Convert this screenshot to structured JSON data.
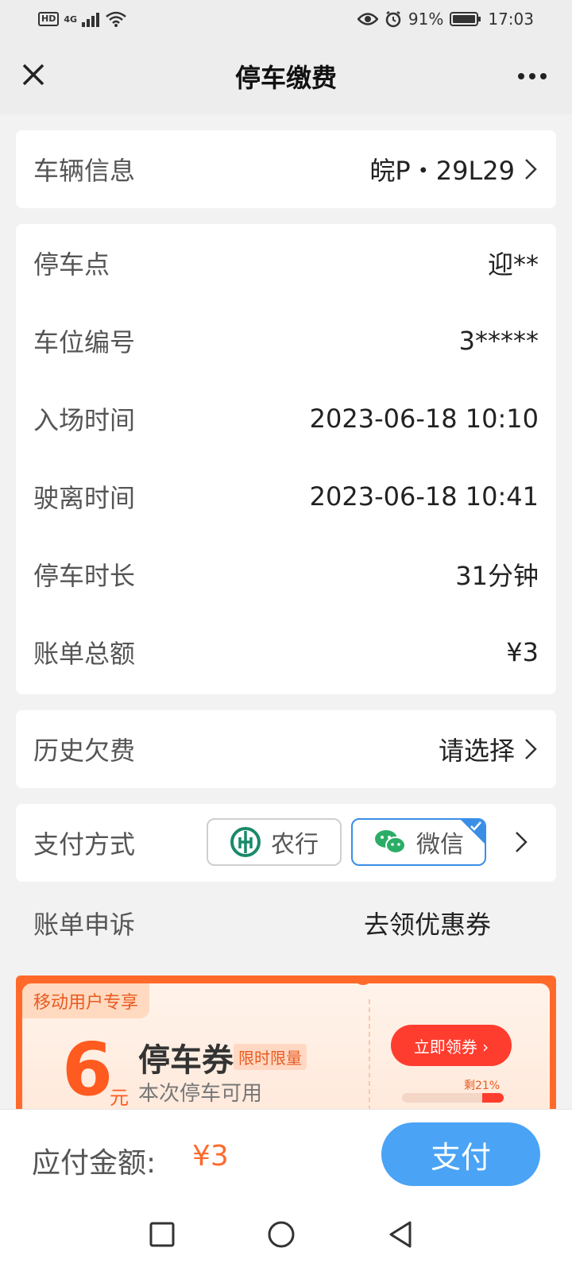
{
  "status_bar": {
    "hd": "HD",
    "network": "4G",
    "battery_percent": "91%",
    "time": "17:03"
  },
  "nav": {
    "title": "停车缴费",
    "close_icon": "close-icon",
    "more_icon": "more-icon"
  },
  "vehicle": {
    "label": "车辆信息",
    "plate": "皖P・29L29"
  },
  "details": [
    {
      "label": "停车点",
      "value": "迎**"
    },
    {
      "label": "车位编号",
      "value": "3*****"
    },
    {
      "label": "入场时间",
      "value": "2023-06-18 10:10"
    },
    {
      "label": "驶离时间",
      "value": "2023-06-18 10:41"
    },
    {
      "label": "停车时长",
      "value": "31分钟"
    },
    {
      "label": "账单总额",
      "value": "¥3"
    }
  ],
  "arrears": {
    "label": "历史欠费",
    "value": "请选择"
  },
  "payment": {
    "label": "支付方式",
    "options": [
      {
        "name": "农行",
        "icon": "abc-bank-icon",
        "selected": false
      },
      {
        "name": "微信",
        "icon": "wechat-icon",
        "selected": true
      }
    ]
  },
  "appeal": {
    "label": "账单申诉",
    "coupon_link": "去领优惠券"
  },
  "promo": {
    "tag": "移动用户专享",
    "amount": "6",
    "unit": "元",
    "title": "停车券",
    "badge": "限时限量",
    "subtitle": "本次停车可用",
    "button": "立即领券 ›",
    "remaining_label": "剩21%",
    "remaining_fraction": 0.21
  },
  "footer": {
    "amount_label": "应付金额:",
    "amount": "¥3",
    "pay_button": "支付"
  },
  "colors": {
    "accent_orange": "#ff6a2b",
    "pay_blue": "#4aa3f5",
    "select_blue": "#3a8ee6",
    "wechat_green": "#2aae67",
    "abc_green": "#1a8a6a"
  }
}
